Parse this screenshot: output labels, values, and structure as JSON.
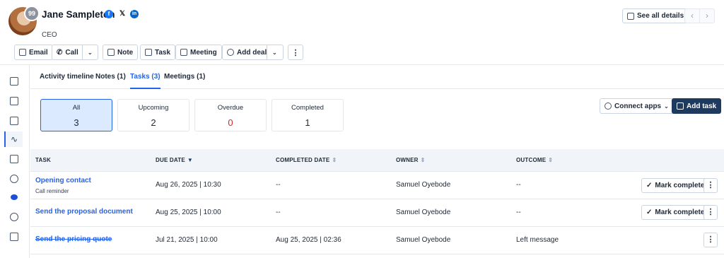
{
  "contact": {
    "name": "Jane Sampleton",
    "score": "99",
    "title": "CEO",
    "social": [
      "facebook-icon",
      "x-icon",
      "linkedin-icon"
    ]
  },
  "actions": {
    "email": "Email",
    "call": "Call",
    "note": "Note",
    "task": "Task",
    "meeting": "Meeting",
    "add_deal": "Add deal"
  },
  "header": {
    "see_all": "See all details"
  },
  "tabs": [
    {
      "label": "Activity timeline"
    },
    {
      "label": "Notes (1)"
    },
    {
      "label": "Tasks (3)"
    },
    {
      "label": "Meetings (1)"
    }
  ],
  "filters": [
    {
      "label": "All",
      "count": "3"
    },
    {
      "label": "Upcoming",
      "count": "2"
    },
    {
      "label": "Overdue",
      "count": "0"
    },
    {
      "label": "Completed",
      "count": "1"
    }
  ],
  "toolbar": {
    "connect_apps": "Connect apps",
    "add_task": "Add task"
  },
  "table": {
    "columns": [
      "TASK",
      "DUE DATE",
      "COMPLETED DATE",
      "OWNER",
      "OUTCOME"
    ],
    "rows": [
      {
        "task": "Opening contact",
        "subtitle": "Call reminder",
        "due": "Aug 26, 2025 | 10:30",
        "completed": "--",
        "owner": "Samuel Oyebode",
        "outcome": "--",
        "action": "Mark complete"
      },
      {
        "task": "Send the proposal document",
        "due": "Aug 25, 2025 | 10:00",
        "completed": "--",
        "owner": "Samuel Oyebode",
        "outcome": "--",
        "action": "Mark complete"
      },
      {
        "task": "Send the pricing quote",
        "due": "Jul 21, 2025 | 10:00",
        "completed": "Aug 25, 2025 | 02:36",
        "owner": "Samuel Oyebode",
        "outcome": "Left message"
      }
    ]
  },
  "colors": {
    "accent": "#2563eb",
    "primary_button": "#1e3a5f",
    "overdue": "#dc2626"
  }
}
